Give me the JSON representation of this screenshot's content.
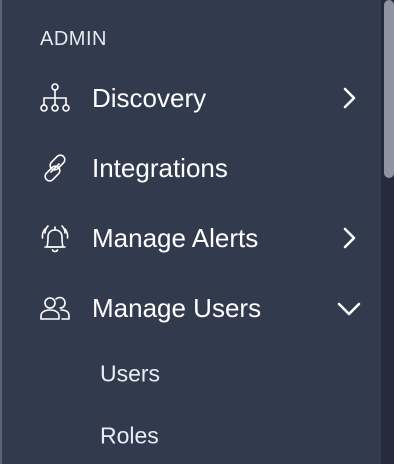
{
  "section": {
    "title": "ADMIN"
  },
  "nav": {
    "items": [
      {
        "label": "Discovery",
        "icon": "hierarchy-icon",
        "chevron": "chevron-right-icon"
      },
      {
        "label": "Integrations",
        "icon": "link-icon",
        "chevron": null
      },
      {
        "label": "Manage Alerts",
        "icon": "alarm-bell-icon",
        "chevron": "chevron-right-icon"
      },
      {
        "label": "Manage Users",
        "icon": "users-icon",
        "chevron": "chevron-down-icon"
      }
    ],
    "sub_items": [
      {
        "label": "Users"
      },
      {
        "label": "Roles"
      }
    ]
  },
  "colors": {
    "background": "#323a4e",
    "text": "#ffffff",
    "scrollbar_thumb": "#8e94a2",
    "scrollbar_track": "#252b3b"
  }
}
